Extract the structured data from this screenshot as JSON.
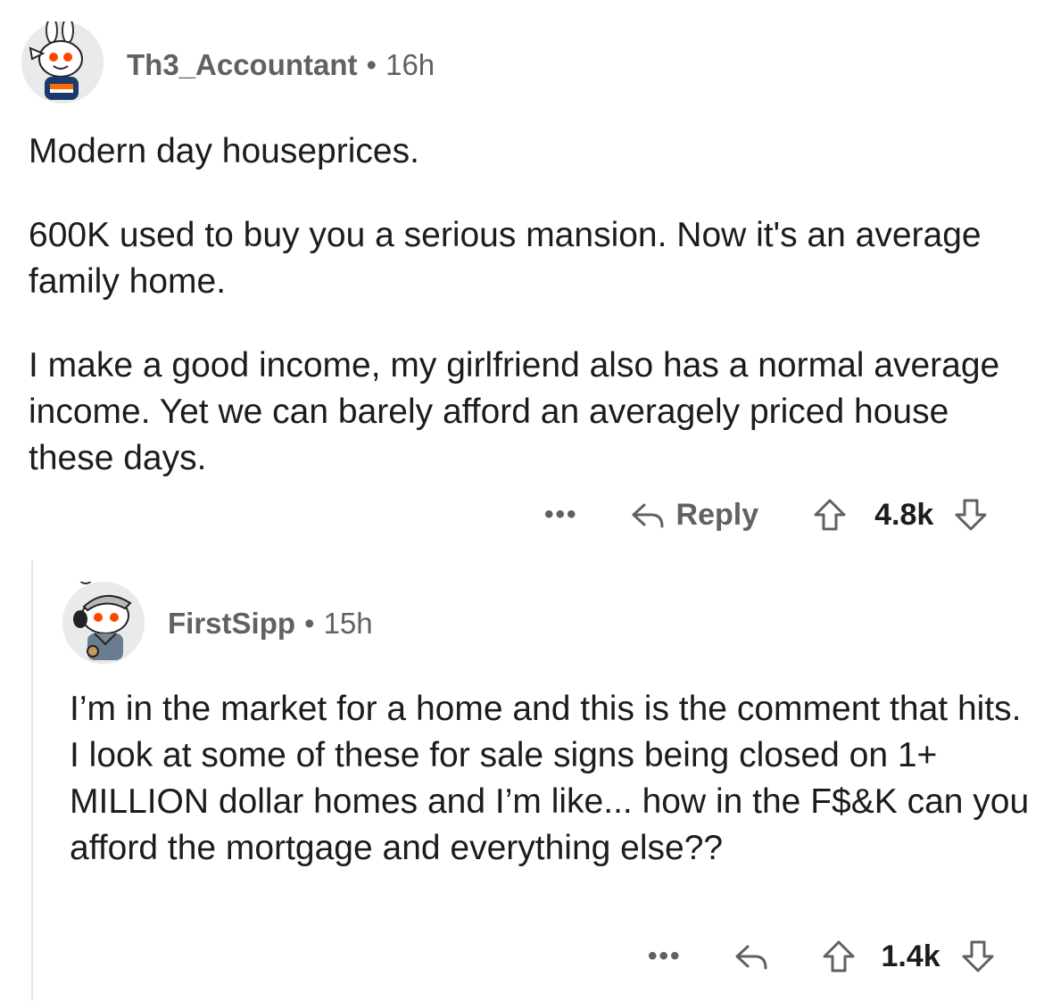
{
  "comments": [
    {
      "username": "Th3_Accountant",
      "separator": "•",
      "time": "16h",
      "paragraphs": [
        "Modern day houseprices.",
        "600K used to buy you a serious mansion. Now it's an average family home.",
        "I make a good income, my girlfriend also has a normal average income. Yet we can barely afford an averagely priced house these days."
      ],
      "more_label": "•••",
      "reply_label": "Reply",
      "votes": "4.8k"
    },
    {
      "username": "FirstSipp",
      "separator": "•",
      "time": "15h",
      "paragraphs": [
        "I’m in the market for a home and this is the comment that hits. I look at some of these for sale signs being closed on 1+ MILLION dollar homes and I’m like... how in the F$&K can you afford the mortgage and everything else??"
      ],
      "more_label": "•••",
      "votes": "1.4k"
    }
  ],
  "icons": {
    "avatar": "snoo-avatar-icon",
    "reply": "reply-arrow-icon",
    "upvote": "upvote-arrow-icon",
    "downvote": "downvote-arrow-icon"
  },
  "colors": {
    "text": "#1c1c1c",
    "meta": "#5f6163",
    "thread_line": "#e4e5e6",
    "avatar_bg": "#e9eaeb"
  }
}
